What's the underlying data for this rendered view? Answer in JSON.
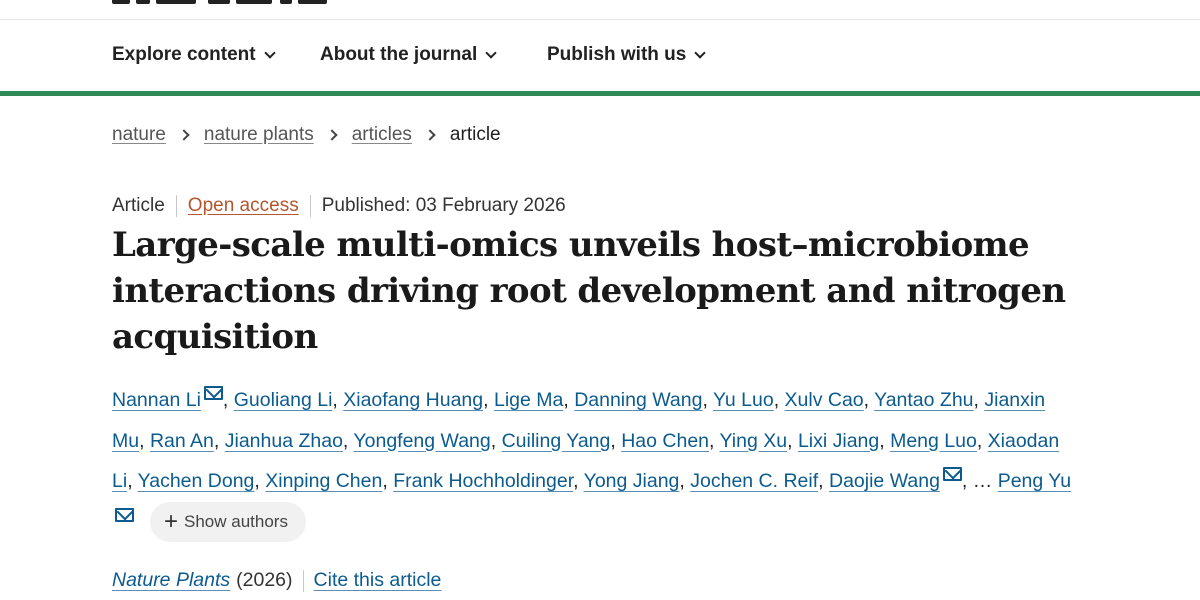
{
  "nav": {
    "items": [
      {
        "label": "Explore content"
      },
      {
        "label": "About the journal"
      },
      {
        "label": "Publish with us"
      }
    ]
  },
  "colors": {
    "accent_bar": "#2e8a57",
    "link": "#0c5b8f",
    "open_access": "#b5562d"
  },
  "breadcrumb": {
    "items": [
      "nature",
      "nature plants",
      "articles"
    ],
    "current": "article"
  },
  "article": {
    "type": "Article",
    "open_access": "Open access",
    "published": "Published: 03 February 2026",
    "title": "Large-scale multi-omics unveils host–microbiome interactions driving root development and nitrogen acquisition"
  },
  "authors": {
    "list": [
      {
        "name": "Nannan Li",
        "mail": true,
        "sep": ", "
      },
      {
        "name": "Guoliang Li",
        "sep": ", "
      },
      {
        "name": "Xiaofang Huang",
        "sep": ", "
      },
      {
        "name": "Lige Ma",
        "sep": ", "
      },
      {
        "name": "Danning Wang",
        "sep": ", "
      },
      {
        "name": "Yu Luo",
        "sep": ", "
      },
      {
        "name": "Xulv Cao",
        "sep": ", "
      },
      {
        "name": "Yantao Zhu",
        "sep": ", "
      },
      {
        "name": "Jianxin Mu",
        "sep": ", "
      },
      {
        "name": "Ran An",
        "sep": ", "
      },
      {
        "name": "Jianhua Zhao",
        "sep": ", "
      },
      {
        "name": "Yongfeng Wang",
        "sep": ", "
      },
      {
        "name": "Cuiling Yang",
        "sep": ", "
      },
      {
        "name": "Hao Chen",
        "sep": ", "
      },
      {
        "name": "Ying Xu",
        "sep": ", "
      },
      {
        "name": "Lixi Jiang",
        "sep": ", "
      },
      {
        "name": "Meng Luo",
        "sep": ", "
      },
      {
        "name": "Xiaodan Li",
        "sep": ", "
      },
      {
        "name": "Yachen Dong",
        "sep": ", "
      },
      {
        "name": "Xinping Chen",
        "sep": ", "
      },
      {
        "name": "Frank Hochholdinger",
        "sep": ", "
      },
      {
        "name": "Yong Jiang",
        "sep": ", "
      },
      {
        "name": "Jochen C. Reif",
        "sep": ", "
      },
      {
        "name": "Daojie Wang",
        "mail": true,
        "sep": ", "
      }
    ],
    "ellipsis": "…",
    "last": {
      "name": "Peng Yu",
      "mail": true
    },
    "show_authors_label": "Show authors"
  },
  "citation": {
    "journal": "Nature Plants",
    "year": "(2026)",
    "cite_label": "Cite this article"
  }
}
